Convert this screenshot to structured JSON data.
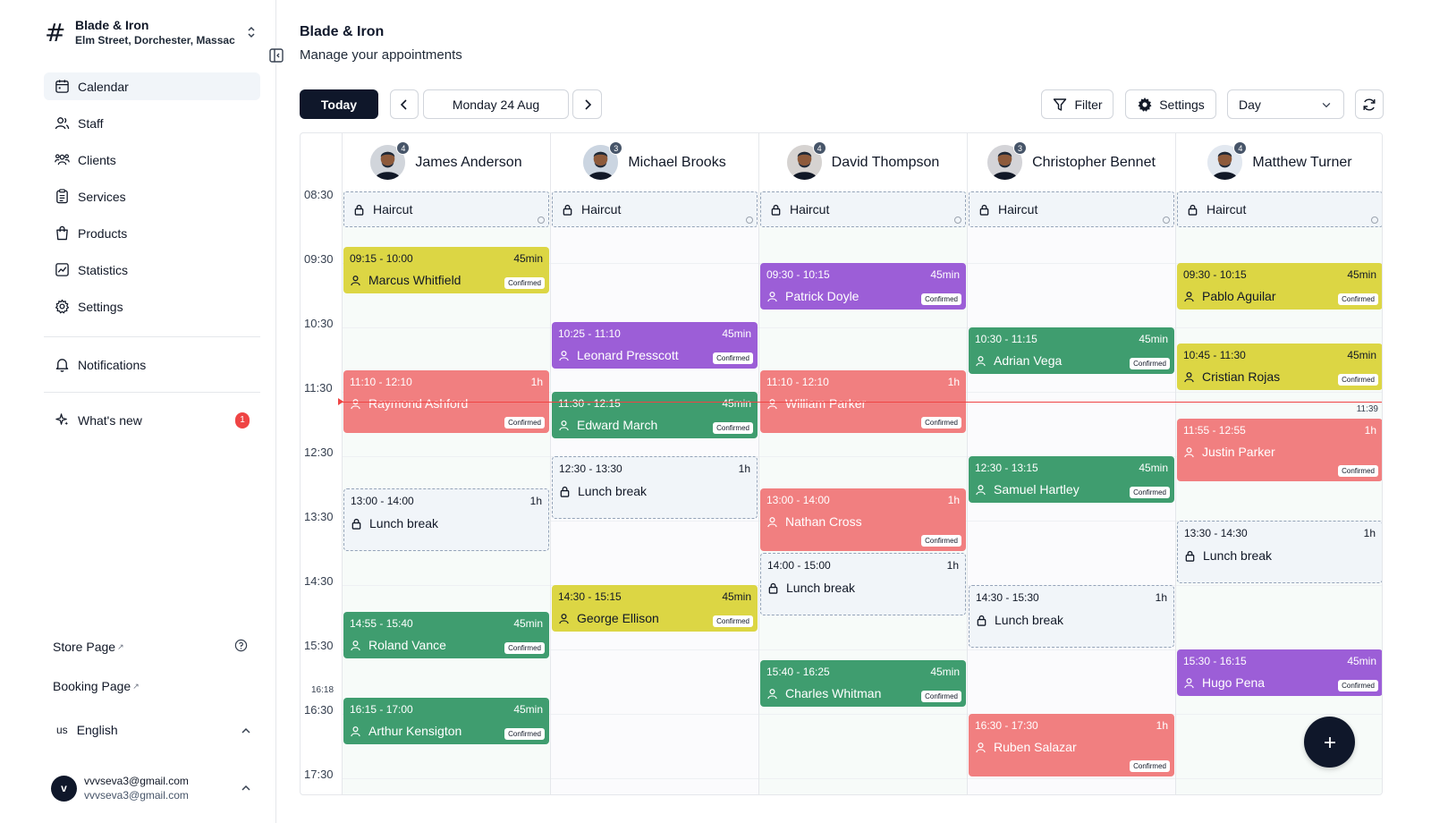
{
  "business": {
    "name": "Blade & Iron",
    "address": "Elm Street, Dorchester, Massac"
  },
  "nav": [
    {
      "label": "Calendar",
      "icon": "calendar-icon",
      "active": true
    },
    {
      "label": "Staff",
      "icon": "staff-icon"
    },
    {
      "label": "Clients",
      "icon": "clients-icon"
    },
    {
      "label": "Services",
      "icon": "services-icon"
    },
    {
      "label": "Products",
      "icon": "products-icon"
    },
    {
      "label": "Statistics",
      "icon": "statistics-icon"
    },
    {
      "label": "Settings",
      "icon": "settings-icon"
    }
  ],
  "notifications_label": "Notifications",
  "whats_new": {
    "label": "What's new",
    "count": "1"
  },
  "store_page": "Store Page",
  "booking_page": "Booking Page",
  "language": {
    "code": "us",
    "label": "English"
  },
  "user": {
    "initial": "v",
    "email1": "vvvseva3@gmail.com",
    "email2": "vvvseva3@gmail.com"
  },
  "header": {
    "title": "Blade & Iron",
    "subtitle": "Manage your appointments"
  },
  "toolbar": {
    "today": "Today",
    "date": "Monday 24 Aug",
    "filter": "Filter",
    "settings": "Settings",
    "view": "Day"
  },
  "time_labels": [
    "08:30",
    "09:30",
    "10:30",
    "11:30",
    "12:30",
    "13:30",
    "14:30",
    "15:30",
    "16:30",
    "17:30"
  ],
  "now_time": "11:39",
  "staff_bottom_time": "16:18",
  "confirmed_label": "Confirmed",
  "haircut_label": "Haircut",
  "colors": {
    "yellow": "#dcd644",
    "red": "#f17f80",
    "green": "#3f9d6f",
    "purple": "#9c5ed7",
    "block": "#f1f5f9"
  },
  "staff": [
    {
      "name": "James Anderson",
      "count": "4",
      "appointments": [
        {
          "time": "09:15 - 10:00",
          "duration": "45min",
          "client": "Marcus Whitfield",
          "color": "yellow",
          "status": "Confirmed",
          "start": 555,
          "end": 600
        },
        {
          "time": "11:10 - 12:10",
          "duration": "1h",
          "client": "Raymond Ashford",
          "color": "red",
          "status": "Confirmed",
          "start": 670,
          "end": 730
        },
        {
          "time": "13:00 - 14:00",
          "duration": "1h",
          "client": "Lunch break",
          "color": "block",
          "start": 780,
          "end": 840
        },
        {
          "time": "14:55 - 15:40",
          "duration": "45min",
          "client": "Roland Vance",
          "color": "green",
          "status": "Confirmed",
          "start": 895,
          "end": 940
        },
        {
          "time": "16:15 - 17:00",
          "duration": "45min",
          "client": "Arthur Kensigton",
          "color": "green",
          "status": "Confirmed",
          "start": 975,
          "end": 1020
        }
      ]
    },
    {
      "name": "Michael Brooks",
      "count": "3",
      "appointments": [
        {
          "time": "10:25 - 11:10",
          "duration": "45min",
          "client": "Leonard Presscott",
          "color": "purple",
          "status": "Confirmed",
          "start": 625,
          "end": 670
        },
        {
          "time": "11:30 - 12:15",
          "duration": "45min",
          "client": "Edward March",
          "color": "green",
          "status": "Confirmed",
          "start": 690,
          "end": 735
        },
        {
          "time": "12:30 - 13:30",
          "duration": "1h",
          "client": "Lunch break",
          "color": "block",
          "start": 750,
          "end": 810
        },
        {
          "time": "14:30 - 15:15",
          "duration": "45min",
          "client": "George Ellison",
          "color": "yellow",
          "status": "Confirmed",
          "start": 870,
          "end": 915
        }
      ]
    },
    {
      "name": "David Thompson",
      "count": "4",
      "appointments": [
        {
          "time": "09:30 - 10:15",
          "duration": "45min",
          "client": "Patrick Doyle",
          "color": "purple",
          "status": "Confirmed",
          "start": 570,
          "end": 615
        },
        {
          "time": "11:10 - 12:10",
          "duration": "1h",
          "client": "William Parker",
          "color": "red",
          "status": "Confirmed",
          "start": 670,
          "end": 730
        },
        {
          "time": "13:00 - 14:00",
          "duration": "1h",
          "client": "Nathan Cross",
          "color": "red",
          "status": "Confirmed",
          "start": 780,
          "end": 840
        },
        {
          "time": "14:00 - 15:00",
          "duration": "1h",
          "client": "Lunch break",
          "color": "block",
          "start": 840,
          "end": 900
        },
        {
          "time": "15:40 - 16:25",
          "duration": "45min",
          "client": "Charles Whitman",
          "color": "green",
          "status": "Confirmed",
          "start": 940,
          "end": 985
        }
      ]
    },
    {
      "name": "Christopher Bennet",
      "count": "3",
      "appointments": [
        {
          "time": "10:30 - 11:15",
          "duration": "45min",
          "client": "Adrian Vega",
          "color": "green",
          "status": "Confirmed",
          "start": 630,
          "end": 675
        },
        {
          "time": "12:30 - 13:15",
          "duration": "45min",
          "client": "Samuel Hartley",
          "color": "green",
          "status": "Confirmed",
          "start": 750,
          "end": 795
        },
        {
          "time": "14:30 - 15:30",
          "duration": "1h",
          "client": "Lunch break",
          "color": "block",
          "start": 870,
          "end": 930
        },
        {
          "time": "16:30 - 17:30",
          "duration": "1h",
          "client": "Ruben Salazar",
          "color": "red",
          "status": "Confirmed",
          "start": 990,
          "end": 1050
        }
      ]
    },
    {
      "name": "Matthew Turner",
      "count": "4",
      "appointments": [
        {
          "time": "09:30 - 10:15",
          "duration": "45min",
          "client": "Pablo Aguilar",
          "color": "yellow",
          "status": "Confirmed",
          "start": 570,
          "end": 615
        },
        {
          "time": "10:45 - 11:30",
          "duration": "45min",
          "client": "Cristian Rojas",
          "color": "yellow",
          "status": "Confirmed",
          "start": 645,
          "end": 690
        },
        {
          "time": "11:55 - 12:55",
          "duration": "1h",
          "client": "Justin Parker",
          "color": "red",
          "status": "Confirmed",
          "start": 715,
          "end": 775
        },
        {
          "time": "13:30 - 14:30",
          "duration": "1h",
          "client": "Lunch break",
          "color": "block",
          "start": 810,
          "end": 870
        },
        {
          "time": "15:30 - 16:15",
          "duration": "45min",
          "client": "Hugo Pena",
          "color": "purple",
          "status": "Confirmed",
          "start": 930,
          "end": 975
        }
      ]
    }
  ]
}
